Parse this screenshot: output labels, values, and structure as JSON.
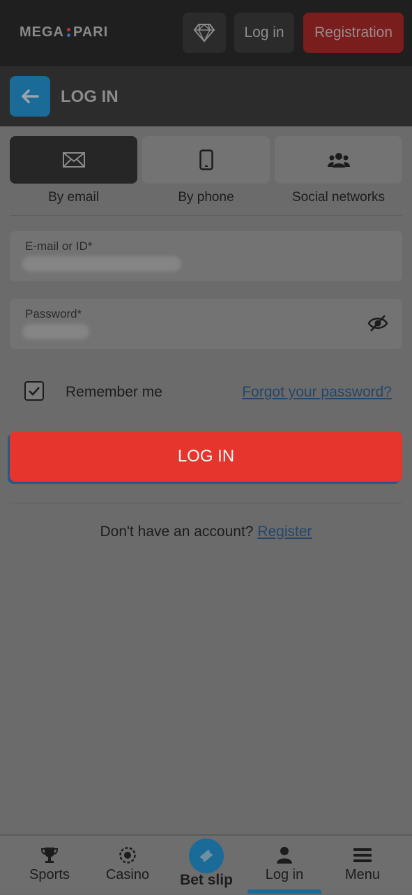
{
  "header": {
    "logo_left": "MEGA",
    "logo_right": "PARI",
    "login_label": "Log in",
    "registration_label": "Registration",
    "logo_dot_colors": [
      "#b33a3a",
      "#3a6fa8"
    ]
  },
  "titlebar": {
    "title": "LOG IN"
  },
  "tabs": [
    {
      "label": "By email",
      "icon": "envelope-icon",
      "active": true
    },
    {
      "label": "By phone",
      "icon": "phone-icon",
      "active": false
    },
    {
      "label": "Social networks",
      "icon": "users-icon",
      "active": false
    }
  ],
  "form": {
    "email_label": "E-mail or ID*",
    "password_label": "Password*",
    "remember_label": "Remember me",
    "remember_checked": true,
    "forgot_label": "Forgot your password?",
    "submit_label": "LOG IN",
    "no_account_text": "Don't have an account?",
    "register_link": "Register"
  },
  "bottom_nav": {
    "items": [
      {
        "label": "Sports",
        "icon": "trophy-icon"
      },
      {
        "label": "Casino",
        "icon": "casino-chip-icon"
      },
      {
        "label": "Bet slip",
        "icon": "ticket-icon"
      },
      {
        "label": "Log in",
        "icon": "user-icon",
        "active": true
      },
      {
        "label": "Menu",
        "icon": "hamburger-menu-icon"
      }
    ]
  },
  "colors": {
    "accent_red": "#e5352c",
    "accent_blue": "#1b6b99",
    "link": "#24466a"
  }
}
